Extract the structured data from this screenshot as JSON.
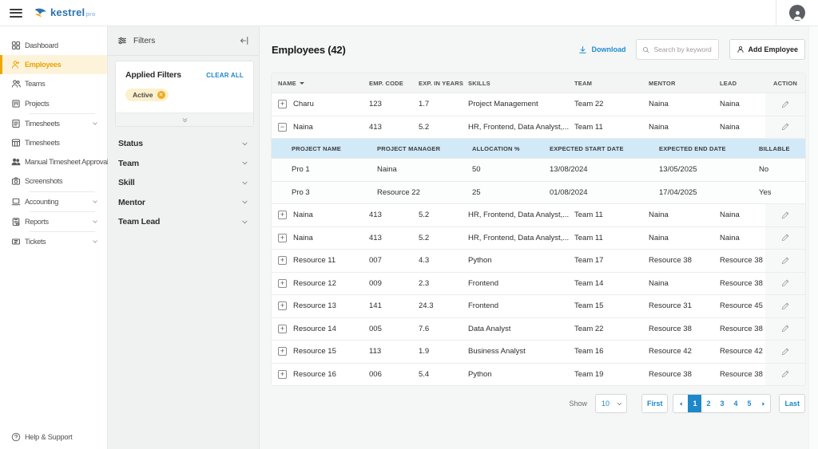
{
  "topbar": {
    "logo_text": "kestrel",
    "logo_suffix": "pro"
  },
  "sidebar": {
    "items": [
      {
        "label": "Dashboard",
        "icon": "dashboard-grid-icon"
      },
      {
        "label": "Employees",
        "icon": "employees-icon",
        "active": true
      },
      {
        "label": "Teams",
        "icon": "teams-icon"
      },
      {
        "label": "Projects",
        "icon": "projects-icon",
        "divider_after": true
      },
      {
        "label": "Timesheets",
        "icon": "timesheet-list-icon",
        "chevron": true
      },
      {
        "label": "Timesheets",
        "icon": "timesheet-grid-icon"
      },
      {
        "label": "Manual Timesheet Approval",
        "icon": "approval-people-icon"
      },
      {
        "label": "Screenshots",
        "icon": "camera-icon",
        "divider_after": true
      },
      {
        "label": "Accounting",
        "icon": "laptop-icon",
        "chevron": true,
        "divider_after": true
      },
      {
        "label": "Reports",
        "icon": "report-icon",
        "chevron": true,
        "divider_after": true
      },
      {
        "label": "Tickets",
        "icon": "ticket-icon",
        "chevron": true
      }
    ],
    "help_label": "Help & Support"
  },
  "filters": {
    "title": "Filters",
    "applied_title": "Applied Filters",
    "clear_all_label": "CLEAR ALL",
    "chips": [
      {
        "label": "Active"
      }
    ],
    "sections": [
      {
        "label": "Status"
      },
      {
        "label": "Team"
      },
      {
        "label": "Skill"
      },
      {
        "label": "Mentor"
      },
      {
        "label": "Team Lead"
      }
    ]
  },
  "main": {
    "title": "Employees (42)",
    "download_label": "Download",
    "search_placeholder": "Search by keyword",
    "add_employee_label": "Add Employee",
    "table": {
      "columns": [
        "NAME",
        "EMP. CODE",
        "EXP. IN YEARS",
        "SKILLS",
        "TEAM",
        "MENTOR",
        "LEAD",
        "ACTION"
      ],
      "rows": [
        {
          "name": "Charu",
          "code": "123",
          "exp": "1.7",
          "skills": "Project Management",
          "team": "Team 22",
          "mentor": "Naina",
          "lead": "Naina"
        },
        {
          "name": "Naina",
          "code": "413",
          "exp": "5.2",
          "skills": "HR, Frontend, Data Analyst,...",
          "team": "Team 11",
          "mentor": "Naina",
          "lead": "Naina",
          "expanded": true
        },
        {
          "name": "Naina",
          "code": "413",
          "exp": "5.2",
          "skills": "HR, Frontend, Data Analyst,...",
          "team": "Team 11",
          "mentor": "Naina",
          "lead": "Naina"
        },
        {
          "name": "Naina",
          "code": "413",
          "exp": "5.2",
          "skills": "HR, Frontend, Data Analyst,...",
          "team": "Team 11",
          "mentor": "Naina",
          "lead": "Naina"
        },
        {
          "name": "Resource 11",
          "code": "007",
          "exp": "4.3",
          "skills": "Python",
          "team": "Team 17",
          "mentor": "Resource 38",
          "lead": "Resource 38"
        },
        {
          "name": "Resource 12",
          "code": "009",
          "exp": "2.3",
          "skills": "Frontend",
          "team": "Team 14",
          "mentor": "Naina",
          "lead": "Resource 38"
        },
        {
          "name": "Resource 13",
          "code": "141",
          "exp": "24.3",
          "skills": "Frontend",
          "team": "Team 15",
          "mentor": "Resource 31",
          "lead": "Resource 45"
        },
        {
          "name": "Resource 14",
          "code": "005",
          "exp": "7.6",
          "skills": "Data Analyst",
          "team": "Team 22",
          "mentor": "Resource 38",
          "lead": "Resource 38"
        },
        {
          "name": "Resource 15",
          "code": "113",
          "exp": "1.9",
          "skills": "Business Analyst",
          "team": "Team 16",
          "mentor": "Resource 42",
          "lead": "Resource 42"
        },
        {
          "name": "Resource 16",
          "code": "006",
          "exp": "5.4",
          "skills": "Python",
          "team": "Team 19",
          "mentor": "Resource 38",
          "lead": "Resource 38"
        }
      ],
      "subtable": {
        "columns": [
          "PROJECT NAME",
          "PROJECT MANAGER",
          "ALLOCATION %",
          "EXPECTED START DATE",
          "EXPECTED END DATE",
          "BILLABLE"
        ],
        "rows": [
          {
            "project": "Pro 1",
            "manager": "Naina",
            "allocation": "50",
            "start": "13/08/2024",
            "end": "13/05/2025",
            "billable": "No"
          },
          {
            "project": "Pro 3",
            "manager": "Resource 22",
            "allocation": "25",
            "start": "01/08/2024",
            "end": "17/04/2025",
            "billable": "Yes"
          }
        ]
      }
    },
    "pagination": {
      "show_label": "Show",
      "page_size": "10",
      "first_label": "First",
      "last_label": "Last",
      "pages": [
        "1",
        "2",
        "3",
        "4",
        "5"
      ],
      "active_page": "1"
    }
  },
  "colors": {
    "accent_blue": "#1d87c9",
    "accent_amber": "#eda400",
    "subtable_header_bg": "#d2e9f8"
  }
}
